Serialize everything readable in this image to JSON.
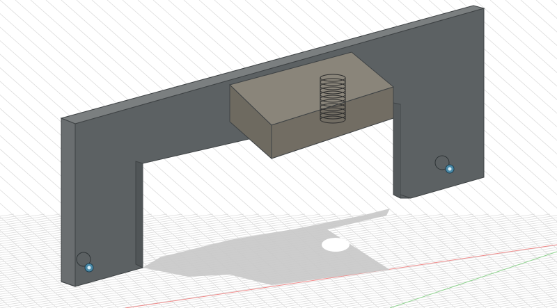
{
  "viewport": {
    "background": "#ffffff",
    "grid_color": "#dcdcdc",
    "axis_x_color": "#f08a8a",
    "axis_z_color": "#8fd48f"
  },
  "model": {
    "body_color": "#5c6163",
    "body_edge_color": "#3e4244",
    "top_face_color": "#7a7f80",
    "block_color": "#6e6a60",
    "block_top_color": "#8a857a",
    "shadow_color": "#c9c9c9",
    "spring_color": "#2b2b2b",
    "marker_icon": "joint-origin-icon"
  }
}
